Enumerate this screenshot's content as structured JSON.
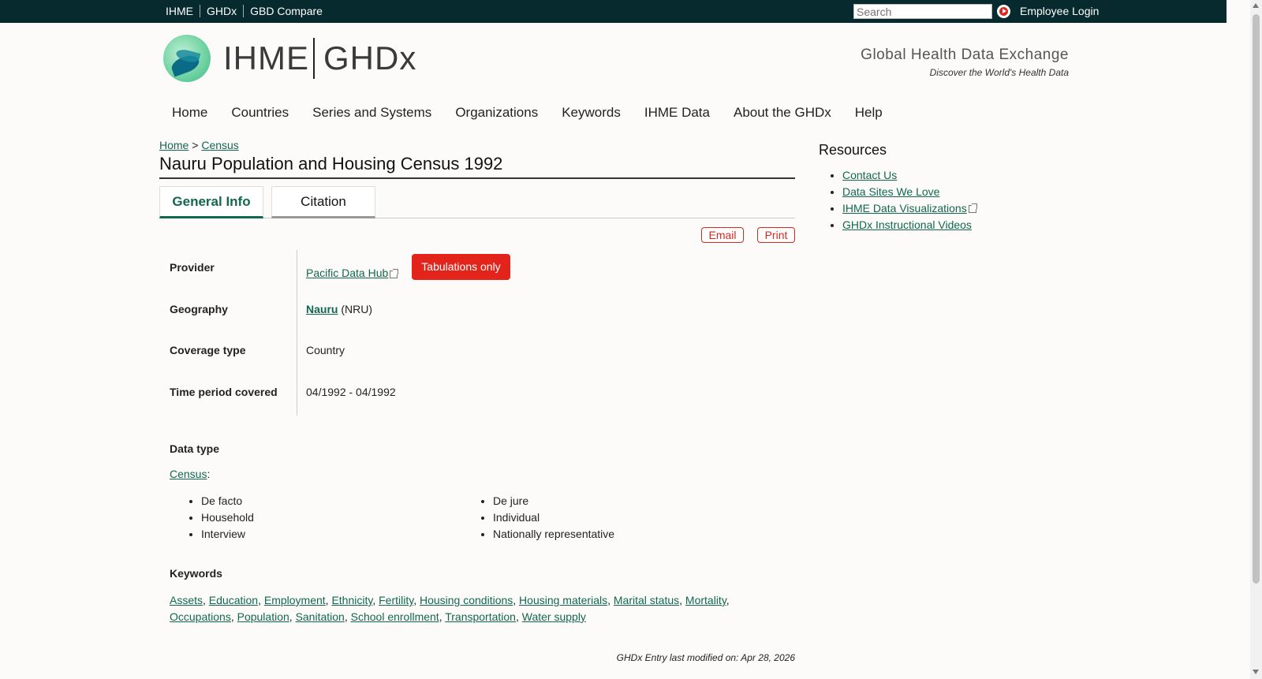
{
  "topbar": {
    "links": [
      "IHME",
      "GHDx",
      "GBD Compare"
    ],
    "search_placeholder": "Search",
    "employee_login": "Employee Login"
  },
  "header": {
    "logo_left": "IHME",
    "logo_right": "GHDx",
    "tagline_title": "Global Health Data Exchange",
    "tagline_sub": "Discover the World's Health Data"
  },
  "nav": [
    "Home",
    "Countries",
    "Series and Systems",
    "Organizations",
    "Keywords",
    "IHME Data",
    "About the GHDx",
    "Help"
  ],
  "breadcrumb": {
    "home": "Home",
    "sep": ">",
    "current": "Census"
  },
  "page_title": "Nauru Population and Housing Census 1992",
  "tabs": {
    "general": "General Info",
    "citation": "Citation"
  },
  "actions": {
    "email": "Email",
    "print": "Print"
  },
  "info": {
    "provider_label": "Provider",
    "provider_value": "Pacific Data Hub",
    "provider_badge": "Tabulations only",
    "geography_label": "Geography",
    "geography_link": "Nauru",
    "geography_code": "(NRU)",
    "coverage_label": "Coverage type",
    "coverage_value": "Country",
    "time_label": "Time period covered",
    "time_value": "04/1992 - 04/1992"
  },
  "data_type": {
    "heading": "Data type",
    "census_link": "Census",
    "left_items": [
      "De facto",
      "Household",
      "Interview"
    ],
    "right_items": [
      "De jure",
      "Individual",
      "Nationally representative"
    ]
  },
  "keywords": {
    "heading": "Keywords",
    "items": [
      "Assets",
      "Education",
      "Employment",
      "Ethnicity",
      "Fertility",
      "Housing conditions",
      "Housing materials",
      "Marital status",
      "Mortality",
      "Occupations",
      "Population",
      "Sanitation",
      "School enrollment",
      "Transportation",
      "Water supply"
    ]
  },
  "modified": "GHDx Entry last modified on: Apr 28, 2026",
  "resources": {
    "title": "Resources",
    "items": [
      "Contact Us",
      "Data Sites We Love",
      "IHME Data Visualizations",
      "GHDx Instructional Videos"
    ]
  },
  "colors": {
    "topbar": "#062a2e",
    "link": "#11684f",
    "accent_red": "#e3241b"
  }
}
